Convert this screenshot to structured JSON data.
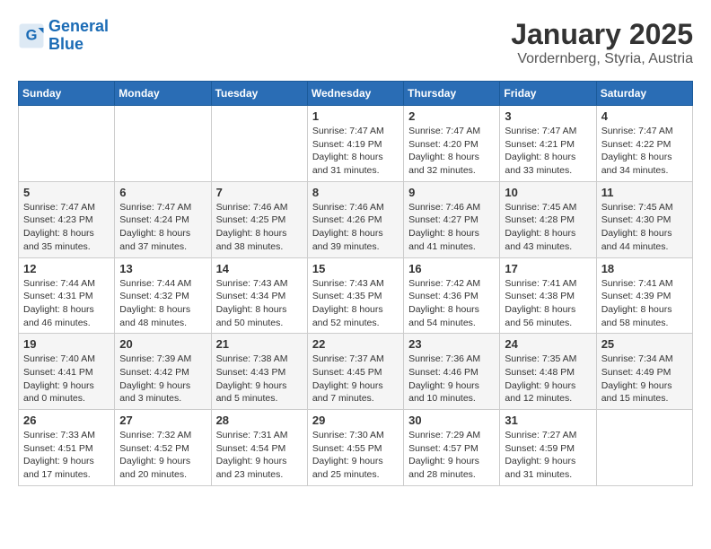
{
  "logo": {
    "line1": "General",
    "line2": "Blue"
  },
  "header": {
    "month": "January 2025",
    "location": "Vordernberg, Styria, Austria"
  },
  "weekdays": [
    "Sunday",
    "Monday",
    "Tuesday",
    "Wednesday",
    "Thursday",
    "Friday",
    "Saturday"
  ],
  "weeks": [
    [
      null,
      null,
      null,
      {
        "day": 1,
        "sunrise": "7:47 AM",
        "sunset": "4:19 PM",
        "daylight": "8 hours and 31 minutes."
      },
      {
        "day": 2,
        "sunrise": "7:47 AM",
        "sunset": "4:20 PM",
        "daylight": "8 hours and 32 minutes."
      },
      {
        "day": 3,
        "sunrise": "7:47 AM",
        "sunset": "4:21 PM",
        "daylight": "8 hours and 33 minutes."
      },
      {
        "day": 4,
        "sunrise": "7:47 AM",
        "sunset": "4:22 PM",
        "daylight": "8 hours and 34 minutes."
      }
    ],
    [
      {
        "day": 5,
        "sunrise": "7:47 AM",
        "sunset": "4:23 PM",
        "daylight": "8 hours and 35 minutes."
      },
      {
        "day": 6,
        "sunrise": "7:47 AM",
        "sunset": "4:24 PM",
        "daylight": "8 hours and 37 minutes."
      },
      {
        "day": 7,
        "sunrise": "7:46 AM",
        "sunset": "4:25 PM",
        "daylight": "8 hours and 38 minutes."
      },
      {
        "day": 8,
        "sunrise": "7:46 AM",
        "sunset": "4:26 PM",
        "daylight": "8 hours and 39 minutes."
      },
      {
        "day": 9,
        "sunrise": "7:46 AM",
        "sunset": "4:27 PM",
        "daylight": "8 hours and 41 minutes."
      },
      {
        "day": 10,
        "sunrise": "7:45 AM",
        "sunset": "4:28 PM",
        "daylight": "8 hours and 43 minutes."
      },
      {
        "day": 11,
        "sunrise": "7:45 AM",
        "sunset": "4:30 PM",
        "daylight": "8 hours and 44 minutes."
      }
    ],
    [
      {
        "day": 12,
        "sunrise": "7:44 AM",
        "sunset": "4:31 PM",
        "daylight": "8 hours and 46 minutes."
      },
      {
        "day": 13,
        "sunrise": "7:44 AM",
        "sunset": "4:32 PM",
        "daylight": "8 hours and 48 minutes."
      },
      {
        "day": 14,
        "sunrise": "7:43 AM",
        "sunset": "4:34 PM",
        "daylight": "8 hours and 50 minutes."
      },
      {
        "day": 15,
        "sunrise": "7:43 AM",
        "sunset": "4:35 PM",
        "daylight": "8 hours and 52 minutes."
      },
      {
        "day": 16,
        "sunrise": "7:42 AM",
        "sunset": "4:36 PM",
        "daylight": "8 hours and 54 minutes."
      },
      {
        "day": 17,
        "sunrise": "7:41 AM",
        "sunset": "4:38 PM",
        "daylight": "8 hours and 56 minutes."
      },
      {
        "day": 18,
        "sunrise": "7:41 AM",
        "sunset": "4:39 PM",
        "daylight": "8 hours and 58 minutes."
      }
    ],
    [
      {
        "day": 19,
        "sunrise": "7:40 AM",
        "sunset": "4:41 PM",
        "daylight": "9 hours and 0 minutes."
      },
      {
        "day": 20,
        "sunrise": "7:39 AM",
        "sunset": "4:42 PM",
        "daylight": "9 hours and 3 minutes."
      },
      {
        "day": 21,
        "sunrise": "7:38 AM",
        "sunset": "4:43 PM",
        "daylight": "9 hours and 5 minutes."
      },
      {
        "day": 22,
        "sunrise": "7:37 AM",
        "sunset": "4:45 PM",
        "daylight": "9 hours and 7 minutes."
      },
      {
        "day": 23,
        "sunrise": "7:36 AM",
        "sunset": "4:46 PM",
        "daylight": "9 hours and 10 minutes."
      },
      {
        "day": 24,
        "sunrise": "7:35 AM",
        "sunset": "4:48 PM",
        "daylight": "9 hours and 12 minutes."
      },
      {
        "day": 25,
        "sunrise": "7:34 AM",
        "sunset": "4:49 PM",
        "daylight": "9 hours and 15 minutes."
      }
    ],
    [
      {
        "day": 26,
        "sunrise": "7:33 AM",
        "sunset": "4:51 PM",
        "daylight": "9 hours and 17 minutes."
      },
      {
        "day": 27,
        "sunrise": "7:32 AM",
        "sunset": "4:52 PM",
        "daylight": "9 hours and 20 minutes."
      },
      {
        "day": 28,
        "sunrise": "7:31 AM",
        "sunset": "4:54 PM",
        "daylight": "9 hours and 23 minutes."
      },
      {
        "day": 29,
        "sunrise": "7:30 AM",
        "sunset": "4:55 PM",
        "daylight": "9 hours and 25 minutes."
      },
      {
        "day": 30,
        "sunrise": "7:29 AM",
        "sunset": "4:57 PM",
        "daylight": "9 hours and 28 minutes."
      },
      {
        "day": 31,
        "sunrise": "7:27 AM",
        "sunset": "4:59 PM",
        "daylight": "9 hours and 31 minutes."
      },
      null
    ]
  ]
}
